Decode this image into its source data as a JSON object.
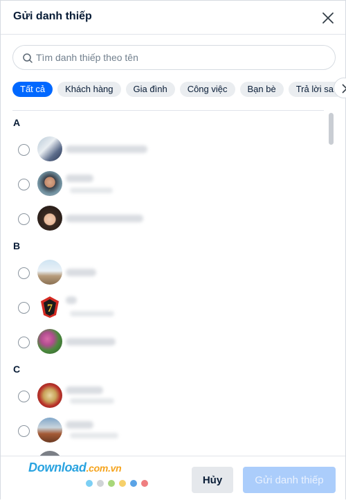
{
  "dialog": {
    "title": "Gửi danh thiếp",
    "close_icon": "close-icon"
  },
  "search": {
    "placeholder": "Tìm danh thiếp theo tên",
    "icon": "search-icon"
  },
  "tabs": [
    {
      "label": "Tất cả",
      "active": true
    },
    {
      "label": "Khách hàng",
      "active": false
    },
    {
      "label": "Gia đình",
      "active": false
    },
    {
      "label": "Công việc",
      "active": false
    },
    {
      "label": "Bạn bè",
      "active": false
    },
    {
      "label": "Trả lời sau",
      "active": false
    }
  ],
  "tabs_next_icon": "chevron-right-icon",
  "groups": [
    {
      "letter": "A",
      "contacts": 3
    },
    {
      "letter": "B",
      "contacts": 3
    },
    {
      "letter": "C",
      "contacts": 3
    }
  ],
  "footer": {
    "watermark_main": "Download",
    "watermark_domain": ".com.vn",
    "watermark_dot_colors": [
      "#7ccff4",
      "#cfd3d6",
      "#a8d77a",
      "#f6d06a",
      "#5aa3e6",
      "#ef7e80"
    ],
    "cancel_label": "Hủy",
    "send_label": "Gửi danh thiếp"
  },
  "colors": {
    "accent": "#0068ff",
    "send_disabled": "#abcdfb",
    "chip_bg": "#eaedf0"
  }
}
